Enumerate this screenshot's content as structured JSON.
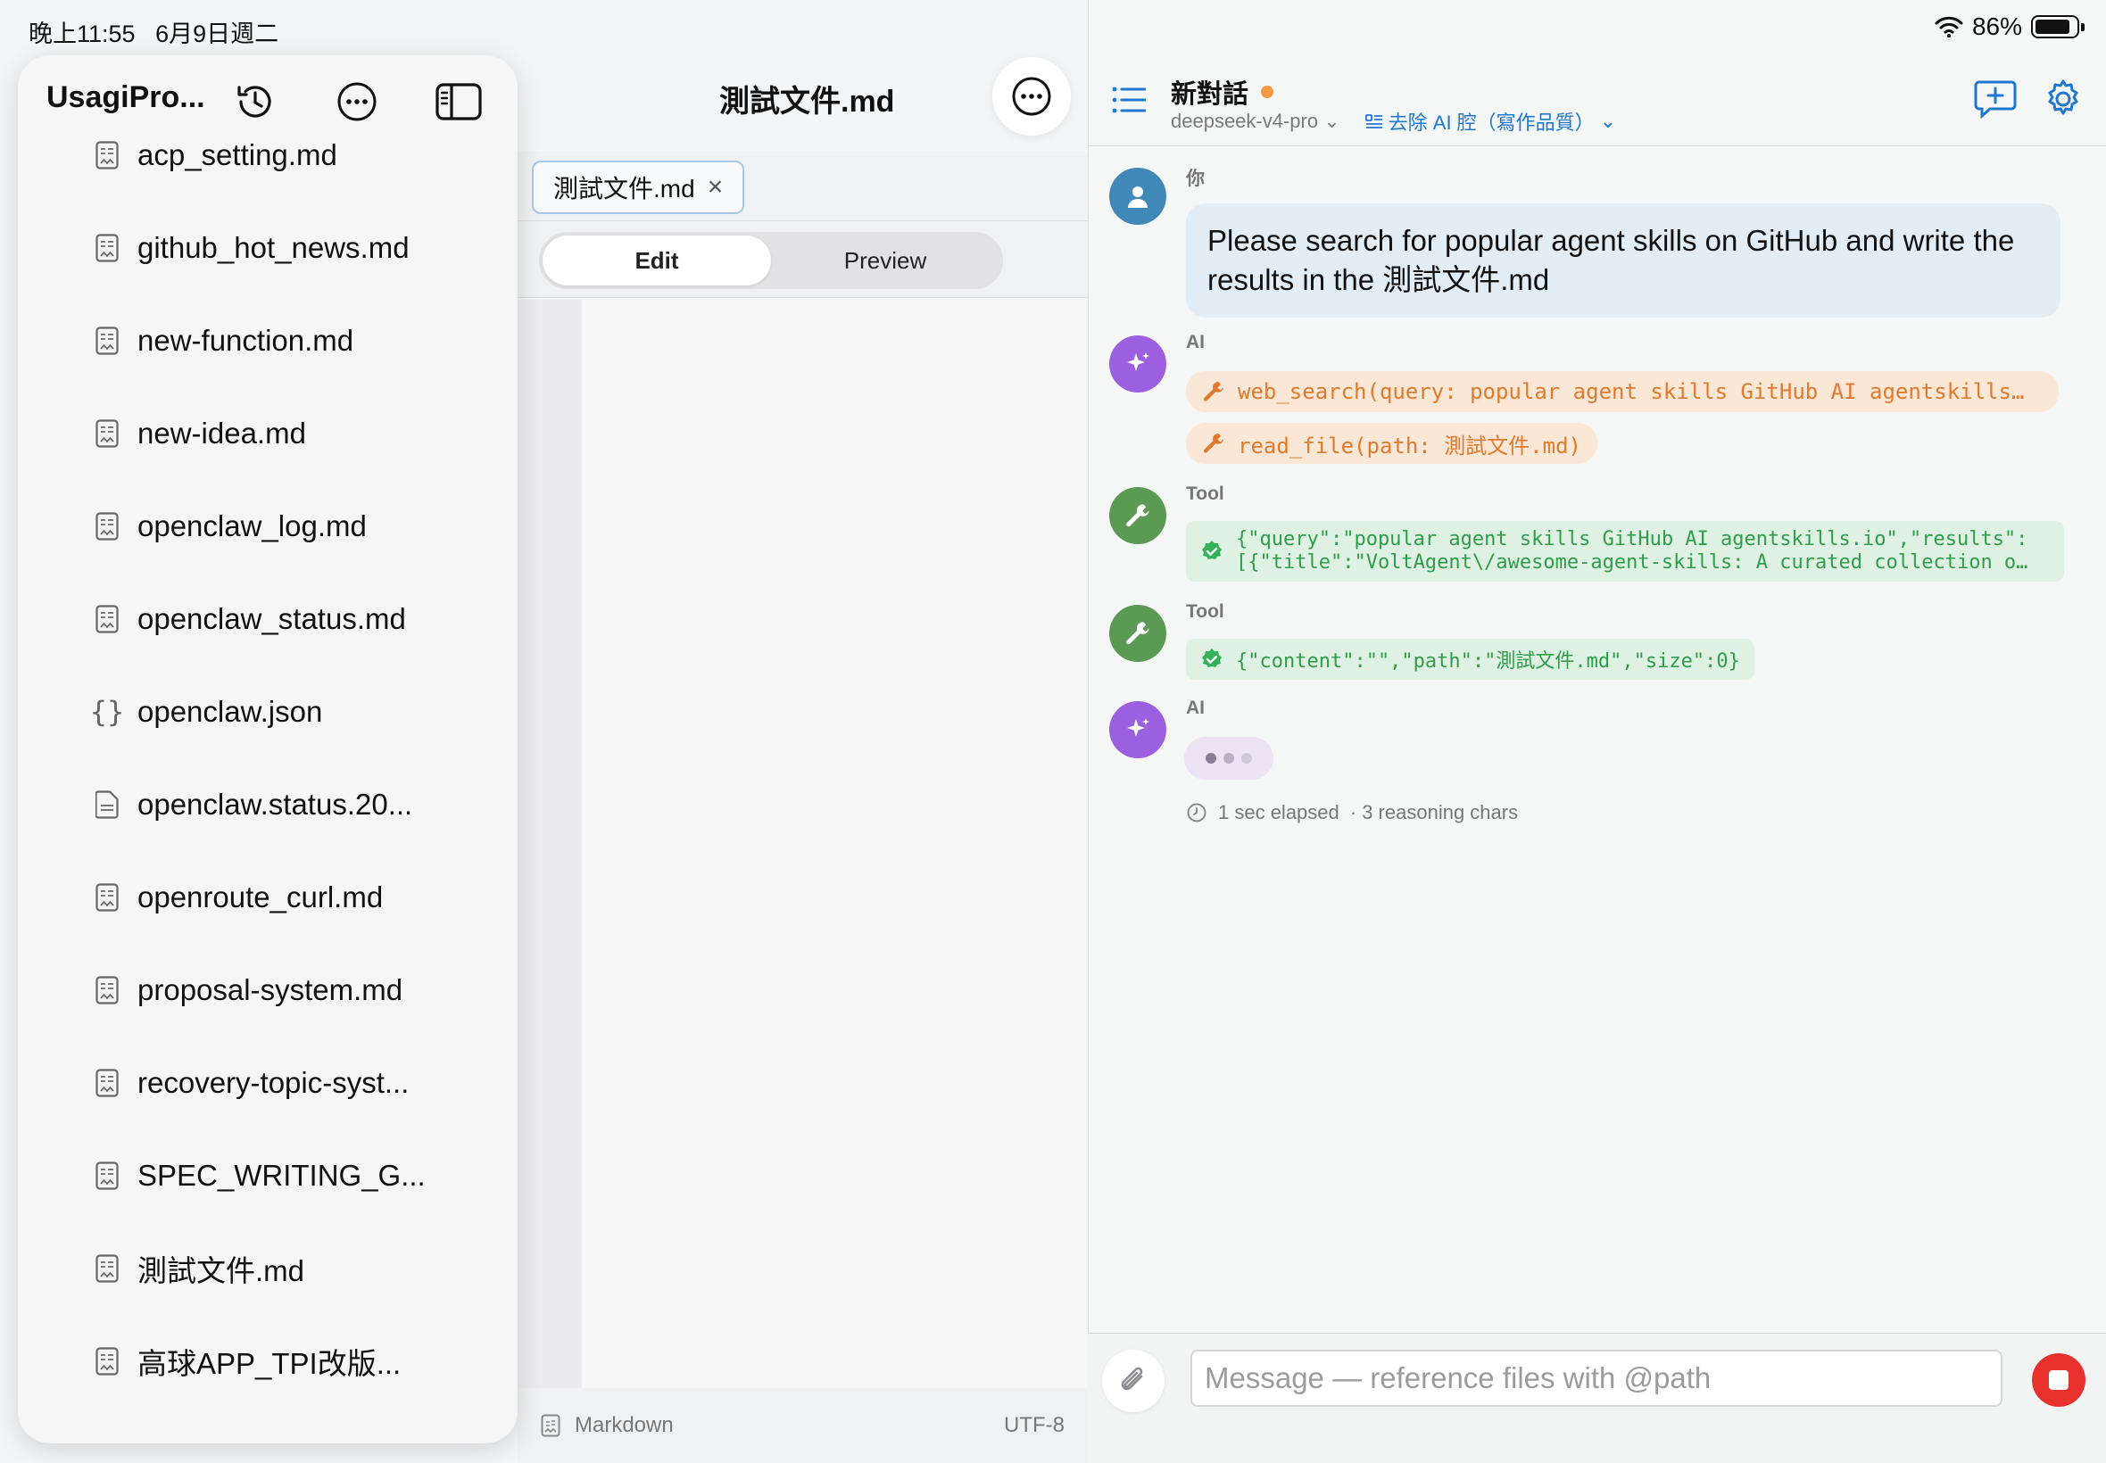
{
  "status": {
    "time": "晚上11:55",
    "date": "6月9日週二",
    "battery": "86%",
    "battery_level": 0.86
  },
  "editor": {
    "title": "測試文件.md",
    "tab_label": "測試文件.md",
    "tab_close": "×",
    "modes": [
      "Edit",
      "Preview"
    ],
    "active_mode": "Edit",
    "footer_lang": "Markdown",
    "footer_encoding": "UTF-8"
  },
  "sidebar": {
    "title": "UsagiPro...",
    "files": [
      {
        "name": "acp_setting.md",
        "icon": "markdown-file-icon"
      },
      {
        "name": "github_hot_news.md",
        "icon": "markdown-file-icon"
      },
      {
        "name": "new-function.md",
        "icon": "markdown-file-icon"
      },
      {
        "name": "new-idea.md",
        "icon": "markdown-file-icon"
      },
      {
        "name": "openclaw_log.md",
        "icon": "markdown-file-icon"
      },
      {
        "name": "openclaw_status.md",
        "icon": "markdown-file-icon"
      },
      {
        "name": "openclaw.json",
        "icon": "json-file-icon"
      },
      {
        "name": "openclaw.status.20...",
        "icon": "text-file-icon"
      },
      {
        "name": "openroute_curl.md",
        "icon": "markdown-file-icon"
      },
      {
        "name": "proposal-system.md",
        "icon": "markdown-file-icon"
      },
      {
        "name": "recovery-topic-syst...",
        "icon": "markdown-file-icon"
      },
      {
        "name": "SPEC_WRITING_G...",
        "icon": "markdown-file-icon"
      },
      {
        "name": "測試文件.md",
        "icon": "markdown-file-icon"
      },
      {
        "name": "高球APP_TPI改版...",
        "icon": "markdown-file-icon"
      }
    ]
  },
  "chat": {
    "title": "新對話",
    "model": "deepseek-v4-pro",
    "mode": "去除 AI 腔（寫作品質）",
    "messages": {
      "user_role": "你",
      "user_text": "Please search for popular agent skills on GitHub and write the results in the 測試文件.md",
      "ai_role": "AI",
      "tool_call_1": "web_search(query: popular agent skills GitHub AI agentskills…",
      "tool_call_2": "read_file(path: 測試文件.md)",
      "tool_role": "Tool",
      "tool_result_1_line1": "{\"query\":\"popular agent skills GitHub AI agentskills.io\",\"results\":",
      "tool_result_1_line2": "[{\"title\":\"VoltAgent\\/awesome-agent-skills: A curated collection o…",
      "tool_result_2": "{\"content\":\"\",\"path\":\"測試文件.md\",\"size\":0}",
      "elapsed": "1 sec elapsed",
      "reasoning": "· 3 reasoning chars"
    },
    "input_placeholder": "Message — reference files with @path"
  }
}
